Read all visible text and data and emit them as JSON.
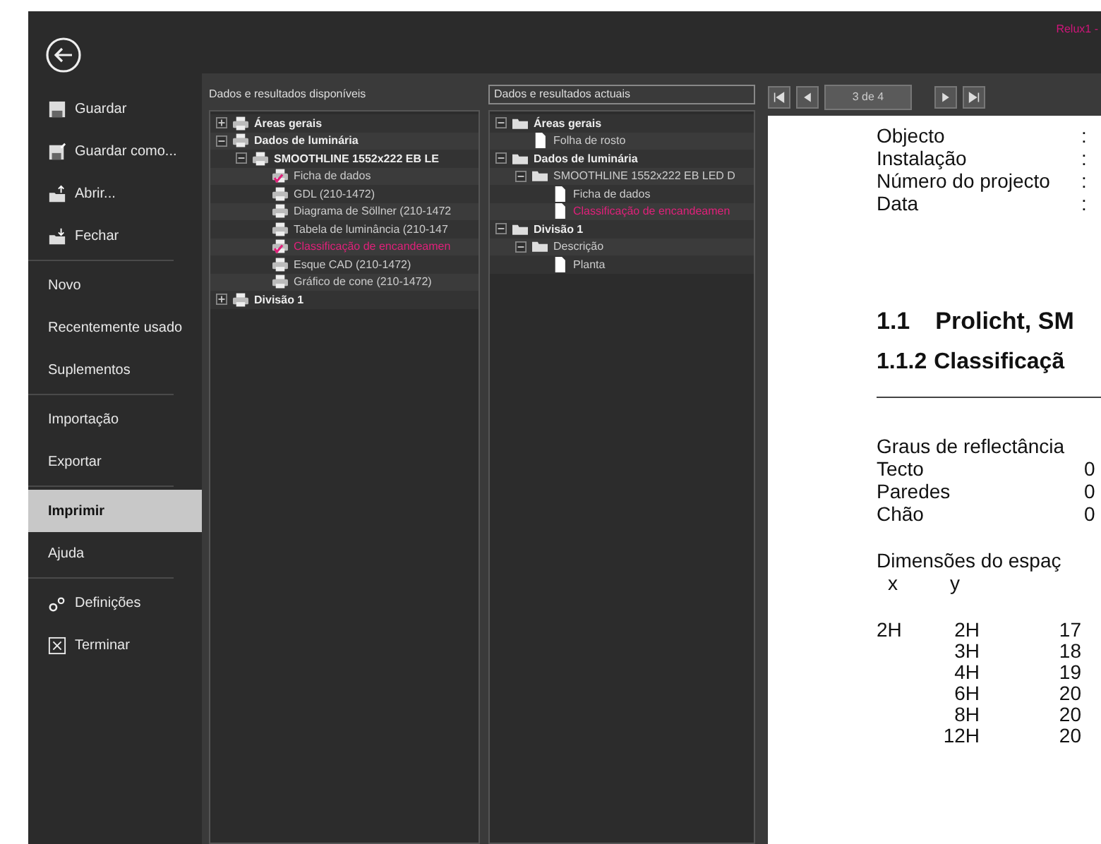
{
  "title": "Relux1 -",
  "menu_groups": [
    {
      "items": [
        {
          "label": "Guardar",
          "kind": "save",
          "selected": false
        },
        {
          "label": "Guardar como...",
          "kind": "save-as",
          "selected": false
        },
        {
          "label": "Abrir...",
          "kind": "open",
          "selected": false
        },
        {
          "label": "Fechar",
          "kind": "close",
          "selected": false
        }
      ]
    },
    {
      "items": [
        {
          "label": "Novo",
          "kind": "plain",
          "selected": false
        },
        {
          "label": "Recentemente usado",
          "kind": "plain",
          "selected": false
        },
        {
          "label": "Suplementos",
          "kind": "plain",
          "selected": false
        }
      ]
    },
    {
      "items": [
        {
          "label": "Importação",
          "kind": "plain",
          "selected": false
        },
        {
          "label": "Exportar",
          "kind": "plain",
          "selected": false
        }
      ]
    },
    {
      "items": [
        {
          "label": "Imprimir",
          "kind": "plain",
          "selected": true
        },
        {
          "label": "Ajuda",
          "kind": "plain",
          "selected": false
        }
      ]
    },
    {
      "items": [
        {
          "label": "Definições",
          "kind": "settings",
          "selected": false
        },
        {
          "label": "Terminar",
          "kind": "exit",
          "selected": false
        }
      ]
    }
  ],
  "available": {
    "label": "Dados e resultados disponíveis",
    "nodes": [
      {
        "label": "Áreas gerais",
        "kind": "printer",
        "bold": true,
        "checked": false,
        "highlighted": false,
        "expanded": false
      },
      {
        "label": "Dados de luminária",
        "kind": "printer",
        "bold": true,
        "checked": false,
        "highlighted": false,
        "expanded": true,
        "children": [
          {
            "label": "SMOOTHLINE 1552x222 EB LE",
            "kind": "printer",
            "bold": true,
            "checked": false,
            "highlighted": false,
            "expanded": true,
            "children": [
              {
                "label": "Ficha de dados",
                "kind": "printer",
                "bold": false,
                "checked": true,
                "highlighted": false
              },
              {
                "label": "GDL (210-1472)",
                "kind": "printer",
                "bold": false,
                "checked": false,
                "highlighted": false
              },
              {
                "label": "Diagrama de Söllner (210-1472",
                "kind": "printer",
                "bold": false,
                "checked": false,
                "highlighted": false
              },
              {
                "label": "Tabela de luminância (210-147",
                "kind": "printer",
                "bold": false,
                "checked": false,
                "highlighted": false
              },
              {
                "label": "Classificação de encandeamen",
                "kind": "printer",
                "bold": false,
                "checked": true,
                "highlighted": true
              },
              {
                "label": "Esque CAD (210-1472)",
                "kind": "printer",
                "bold": false,
                "checked": false,
                "highlighted": false
              },
              {
                "label": "Gráfico de cone (210-1472)",
                "kind": "printer",
                "bold": false,
                "checked": false,
                "highlighted": false
              }
            ]
          }
        ]
      },
      {
        "label": "Divisão 1",
        "kind": "printer",
        "bold": true,
        "checked": false,
        "highlighted": false,
        "expanded": false
      }
    ]
  },
  "current": {
    "label": "Dados e resultados actuais",
    "nodes": [
      {
        "label": "Áreas gerais",
        "kind": "folder",
        "bold": true,
        "highlighted": false,
        "expanded": true,
        "children": [
          {
            "label": "Folha de rosto",
            "kind": "page",
            "bold": false,
            "highlighted": false
          }
        ]
      },
      {
        "label": "Dados de luminária",
        "kind": "folder",
        "bold": true,
        "highlighted": false,
        "expanded": true,
        "children": [
          {
            "label": "SMOOTHLINE 1552x222 EB LED D",
            "kind": "folder",
            "bold": false,
            "highlighted": false,
            "expanded": true,
            "children": [
              {
                "label": "Ficha de dados",
                "kind": "page",
                "bold": false,
                "highlighted": false
              },
              {
                "label": "Classificação de encandeamen",
                "kind": "page",
                "bold": false,
                "highlighted": true
              }
            ]
          }
        ]
      },
      {
        "label": "Divisão 1",
        "kind": "folder",
        "bold": true,
        "highlighted": false,
        "expanded": true,
        "children": [
          {
            "label": "Descrição",
            "kind": "folder",
            "bold": false,
            "highlighted": false,
            "expanded": true,
            "children": [
              {
                "label": "Planta",
                "kind": "page",
                "bold": false,
                "highlighted": false
              }
            ]
          }
        ]
      }
    ]
  },
  "preview": {
    "page_field": "3 de 4",
    "info_rows": [
      {
        "label": "Objecto",
        "separator": ":"
      },
      {
        "label": "Instalação",
        "separator": ":"
      },
      {
        "label": "Número do projecto",
        "separator": ":"
      },
      {
        "label": "Data",
        "separator": ":"
      }
    ],
    "heading_1": {
      "number": "1.1",
      "title": "Prolicht, SM"
    },
    "heading_2": {
      "number": "1.1.2",
      "title": "Classificaçã"
    },
    "reflectance": {
      "title": "Graus de reflectância",
      "rows": [
        {
          "label": "Tecto",
          "value": "0"
        },
        {
          "label": "Paredes",
          "value": "0"
        },
        {
          "label": "Chão",
          "value": "0"
        }
      ]
    },
    "room": {
      "title": "Dimensões do espaç",
      "columns": [
        "x",
        "y"
      ],
      "rows": [
        {
          "x": "2H",
          "y": "2H",
          "value": "17"
        },
        {
          "y": "3H",
          "value": "18"
        },
        {
          "y": "4H",
          "value": "19"
        },
        {
          "y": "6H",
          "value": "20"
        },
        {
          "y": "8H",
          "value": "20"
        },
        {
          "y": "12H",
          "value": "20"
        }
      ]
    }
  }
}
